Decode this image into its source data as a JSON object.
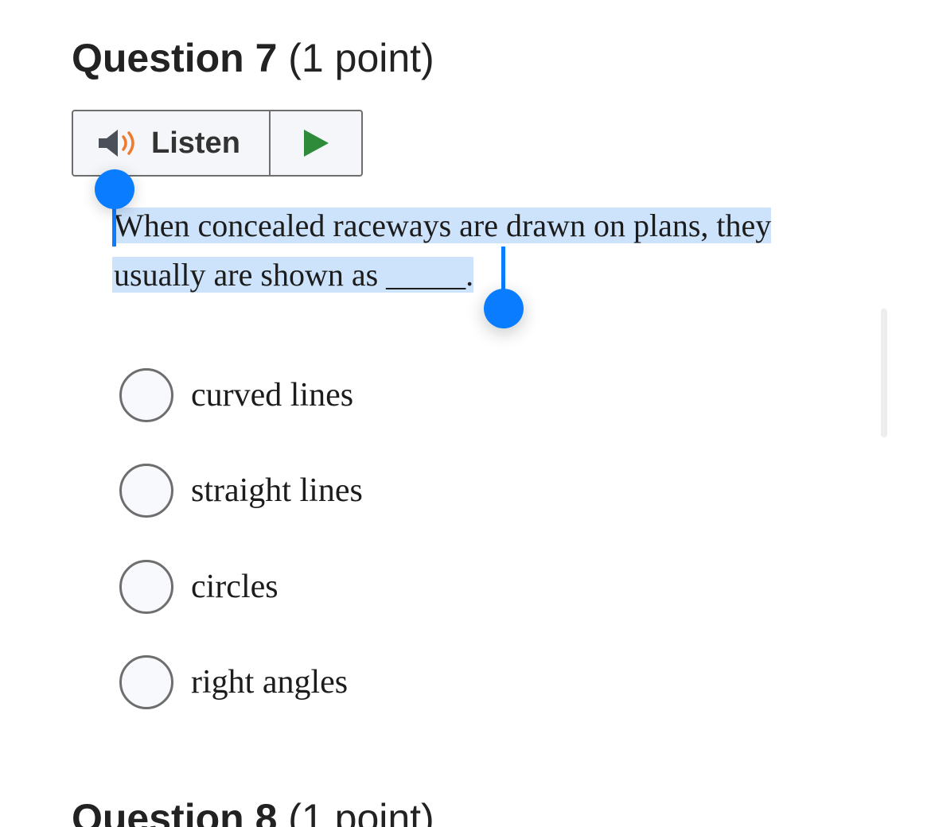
{
  "question": {
    "title": "Question 7",
    "points": "(1 point)",
    "text_line1": "When concealed raceways are drawn on plans, they",
    "text_line2": "usually are shown as _____."
  },
  "listen": {
    "label": "Listen",
    "speaker_icon": "speaker-icon",
    "play_icon": "play-icon",
    "accent_color": "#ee7a2e",
    "play_color": "#2e8b3a"
  },
  "options": [
    {
      "label": "curved lines",
      "selected": false
    },
    {
      "label": "straight lines",
      "selected": false
    },
    {
      "label": "circles",
      "selected": false
    },
    {
      "label": "right angles",
      "selected": false
    }
  ],
  "next_question": {
    "title": "Question 8",
    "points": "(1 point)"
  },
  "selection": {
    "highlight_color": "#cde3fb",
    "handle_color": "#0a7cff"
  }
}
